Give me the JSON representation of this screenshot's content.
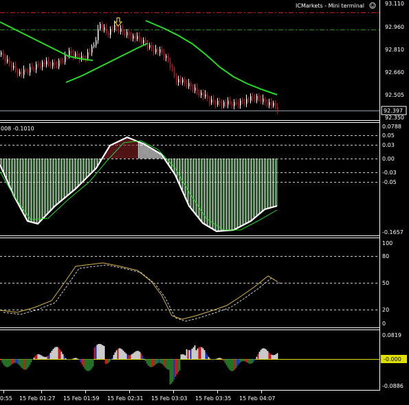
{
  "header": {
    "title": "ICMarkets - Mini terminal",
    "smile_icon": "smile-icon"
  },
  "colors": {
    "background": "#000000",
    "frame": "#ffffff",
    "bull_candle": "#ffffff",
    "bear_candle": "#c01020",
    "ma_line": "#22dd22",
    "level_red": "#d01818",
    "level_green": "#2e8b20",
    "hist_green": "#2e8b2e",
    "hist_red": "#8b1020",
    "signal_line": "#ffffff",
    "stoch_main": "#d8b24a",
    "stoch_signal": "#d0d0d0",
    "zero_line": "#e0e000",
    "arrow": "#e8c830"
  },
  "price_panel": {
    "ticks": [
      "93.110",
      "92.960",
      "92.810",
      "92.660",
      "92.505",
      "92.350"
    ],
    "current_price": "92.397",
    "arrow_icon": "down-arrow-icon"
  },
  "macd_panel": {
    "label": "008 -0.1010",
    "ticks": [
      "0.0788",
      "0.05",
      "0.03",
      "0.00",
      "-0.03",
      "-0.05",
      "-0.1657"
    ]
  },
  "stoch_panel": {
    "ticks": [
      "100",
      "80",
      "50",
      "20",
      "0"
    ]
  },
  "osc_panel": {
    "ticks": [
      "0.0819",
      "-0.000",
      "-0.0886"
    ]
  },
  "time_axis": {
    "labels": [
      "0:55",
      "15 Feb 01:27",
      "15 Feb 01:59",
      "15 Feb 02:31",
      "15 Feb 03:03",
      "15 Feb 03:35",
      "15 Feb 04:07"
    ]
  }
}
